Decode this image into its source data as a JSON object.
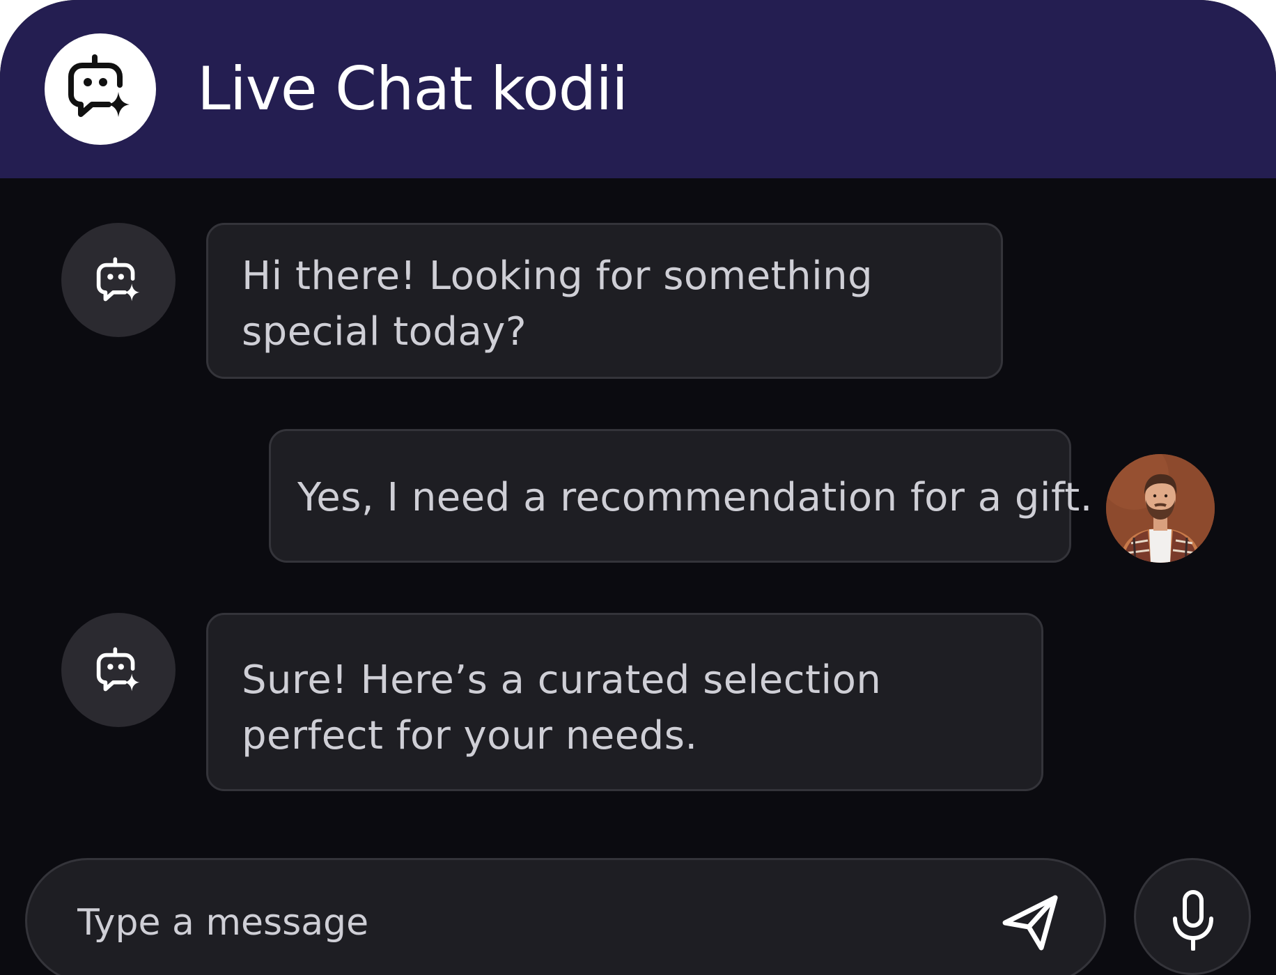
{
  "header": {
    "title": "Live Chat kodii",
    "logo_icon": "bot-sparkle-icon"
  },
  "messages": [
    {
      "sender": "bot",
      "avatar_icon": "bot-sparkle-icon",
      "text": "Hi there! Looking for something special today?"
    },
    {
      "sender": "user",
      "avatar": "user-photo",
      "text": "Yes, I need a recommendation for a gift."
    },
    {
      "sender": "bot",
      "avatar_icon": "bot-sparkle-icon",
      "text": "Sure! Here’s a curated selection perfect for your needs."
    }
  ],
  "composer": {
    "placeholder": "Type a message",
    "value": "",
    "send_icon": "send-icon",
    "mic_icon": "microphone-icon"
  },
  "colors": {
    "header_bg": "#241e51",
    "body_bg": "#0b0b10",
    "bubble_bg": "#1e1e23",
    "bubble_border": "#34343a",
    "text": "#cfcfd6"
  }
}
